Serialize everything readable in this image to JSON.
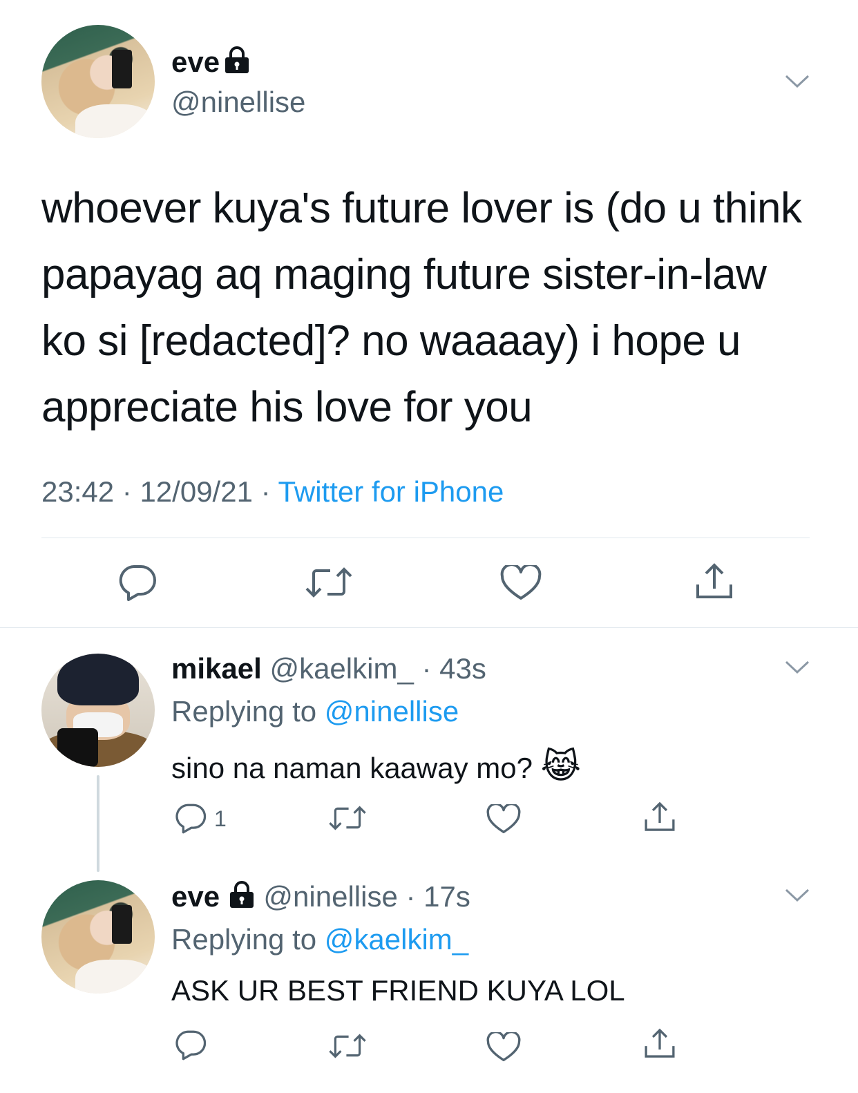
{
  "main_tweet": {
    "author_name": "eve",
    "author_handle": "@ninellise",
    "text": "whoever kuya's future lover is (do u think papayag aq maging future sister-in-law ko si [redacted]? no waaaay) i hope u appreciate his love for you",
    "time": "23:42",
    "date": "12/09/21",
    "source": "Twitter for iPhone",
    "separator": "·"
  },
  "replies": [
    {
      "author_name": "mikael",
      "author_handle": "@kaelkim_",
      "age": "43s",
      "replying_label": "Replying to",
      "replying_to": "@ninellise",
      "text": "sino na naman kaaway mo?",
      "emoji": "😹",
      "reply_count": "1"
    },
    {
      "author_name": "eve",
      "author_handle": "@ninellise",
      "age": "17s",
      "replying_label": "Replying to",
      "replying_to": "@kaelkim_",
      "text": "ASK UR BEST FRIEND KUYA LOL"
    }
  ],
  "icons": {
    "lock": "lock-icon",
    "reply": "reply-icon",
    "retweet": "retweet-icon",
    "like": "heart-icon",
    "share": "share-icon",
    "more": "chevron-down-icon"
  },
  "colors": {
    "accent": "#1d9bf0",
    "secondary_text": "#536471",
    "divider": "#e1e8ed"
  }
}
